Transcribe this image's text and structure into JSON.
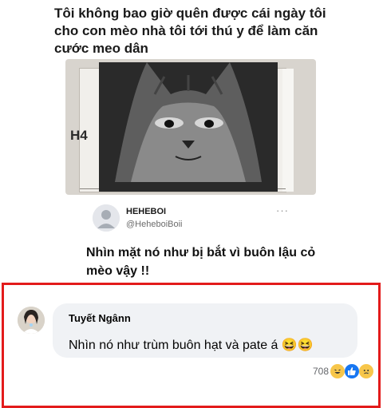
{
  "post": {
    "headline": "Tôi không bao giờ quên được cái ngày tôi cho con mèo nhà tôi tới thú y để làm căn cước meo dân",
    "photo_label": "H4",
    "tweet": {
      "name": "HEHEBOI",
      "handle": "@HeheboiBoii",
      "more_label": "···",
      "text": "Nhìn mặt nó như bị bắt vì buôn lậu cỏ mèo vậy !!"
    }
  },
  "comment": {
    "author": "Tuyết Ngânn",
    "text": "Nhìn nó như trùm buôn hạt và pate á 😆😆",
    "reaction_count": "708",
    "reactions": [
      "haha-reaction-icon",
      "like-reaction-icon",
      "sad-reaction-icon"
    ]
  },
  "colors": {
    "highlight_border": "#e31b1b",
    "bubble": "#f0f2f5"
  }
}
